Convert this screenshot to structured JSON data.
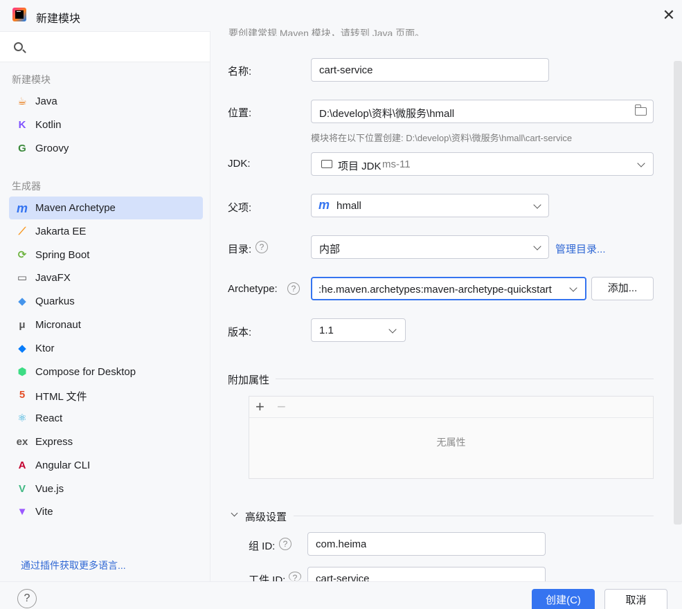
{
  "window": {
    "title": "新建模块",
    "close": "✕"
  },
  "sidebar": {
    "search_placeholder": "",
    "section_new": "新建模块",
    "new_items": [
      {
        "label": "Java",
        "icon": "java-icon",
        "glyph": "☕",
        "color": "#e76f00"
      },
      {
        "label": "Kotlin",
        "icon": "kotlin-icon",
        "glyph": "K",
        "color": "#7f52ff"
      },
      {
        "label": "Groovy",
        "icon": "groovy-icon",
        "glyph": "G",
        "color": "#3c8a3c"
      }
    ],
    "section_gen": "生成器",
    "gen_items": [
      {
        "label": "Maven Archetype",
        "icon": "maven-icon",
        "glyph": "m",
        "color": "#3574f0",
        "active": true
      },
      {
        "label": "Jakarta EE",
        "icon": "jakarta-icon",
        "glyph": "⟋",
        "color": "#f89820"
      },
      {
        "label": "Spring Boot",
        "icon": "spring-boot-icon",
        "glyph": "⟳",
        "color": "#6db33f"
      },
      {
        "label": "JavaFX",
        "icon": "javafx-icon",
        "glyph": "▭",
        "color": "#555555"
      },
      {
        "label": "Quarkus",
        "icon": "quarkus-icon",
        "glyph": "◆",
        "color": "#4695eb"
      },
      {
        "label": "Micronaut",
        "icon": "micronaut-icon",
        "glyph": "μ",
        "color": "#555555"
      },
      {
        "label": "Ktor",
        "icon": "ktor-icon",
        "glyph": "◆",
        "color": "#087cfa"
      },
      {
        "label": "Compose for Desktop",
        "icon": "compose-icon",
        "glyph": "⬢",
        "color": "#3ddc84"
      },
      {
        "label": "HTML 文件",
        "icon": "html-icon",
        "glyph": "5",
        "color": "#e44d26"
      },
      {
        "label": "React",
        "icon": "react-icon",
        "glyph": "⚛",
        "color": "#26a8d8"
      },
      {
        "label": "Express",
        "icon": "express-icon",
        "glyph": "ex",
        "color": "#555555"
      },
      {
        "label": "Angular CLI",
        "icon": "angular-icon",
        "glyph": "A",
        "color": "#c3002f"
      },
      {
        "label": "Vue.js",
        "icon": "vue-icon",
        "glyph": "V",
        "color": "#41b883"
      },
      {
        "label": "Vite",
        "icon": "vite-icon",
        "glyph": "▼",
        "color": "#9b59ff"
      }
    ],
    "plugin_link": "通过插件获取更多语言..."
  },
  "form": {
    "top_note": "要创建常规 Maven 模块，请转到 Java 页面。",
    "name_label": "名称:",
    "name_value": "cart-service",
    "location_label": "位置:",
    "location_value": "D:\\develop\\资料\\微服务\\hmall",
    "location_hint": "模块将在以下位置创建: D:\\develop\\资料\\微服务\\hmall\\cart-service",
    "jdk_label": "JDK:",
    "jdk_prefix": "项目 JDK",
    "jdk_value": "ms-11",
    "parent_label": "父项:",
    "parent_value": "hmall",
    "catalog_label": "目录:",
    "catalog_value": "内部",
    "catalog_link": "管理目录...",
    "archetype_label": "Archetype:",
    "archetype_value": ":he.maven.archetypes:maven-archetype-quickstart",
    "archetype_add": "添加...",
    "version_label": "版本:",
    "version_value": "1.1",
    "props_title": "附加属性",
    "props_empty": "无属性",
    "props_add": "+",
    "props_remove": "−",
    "advanced_title": "高级设置",
    "group_label": "组 ID:",
    "group_value": "com.heima",
    "artifact_label": "工件 ID:",
    "artifact_value": "cart-service",
    "help_glyph": "?"
  },
  "footer": {
    "help": "?",
    "create": "创建(C)",
    "cancel": "取消"
  }
}
